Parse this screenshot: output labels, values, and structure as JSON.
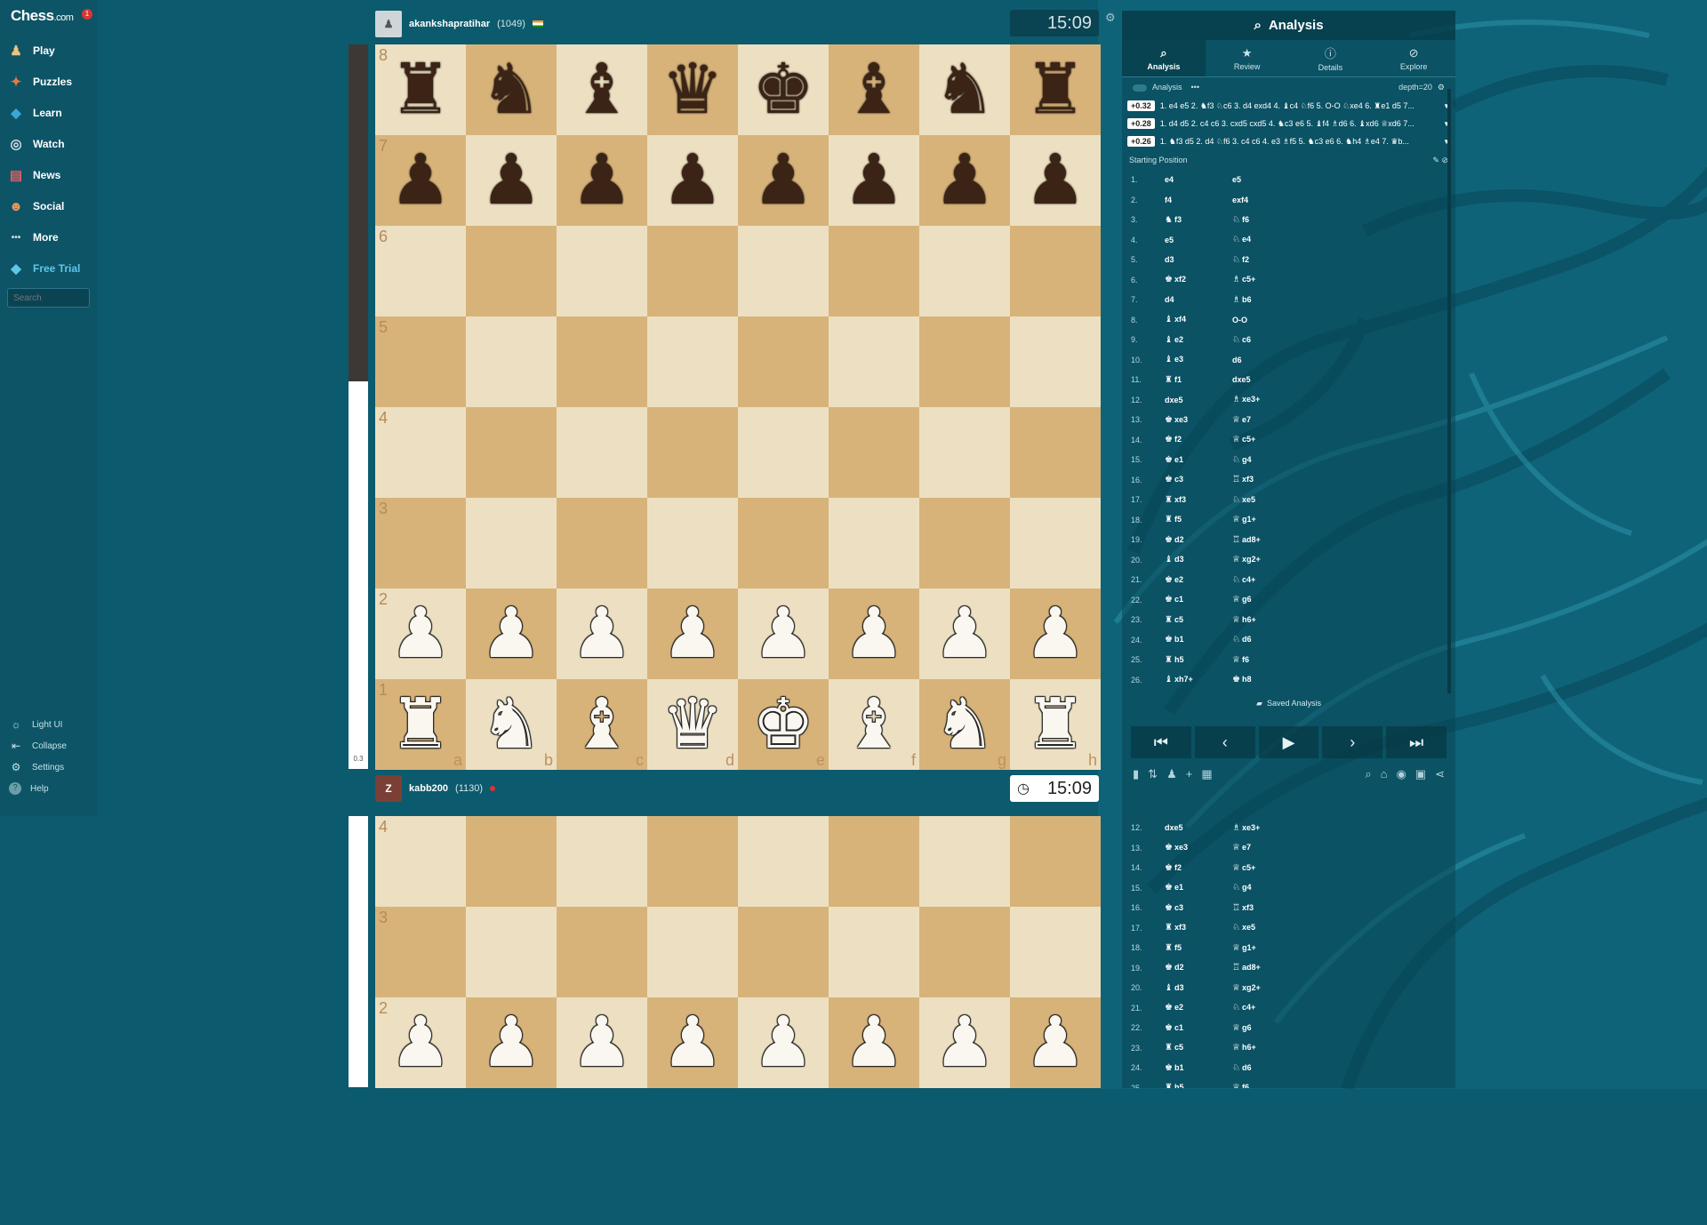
{
  "brand": {
    "logo_main": "Chess",
    "logo_suffix": ".com",
    "notification_count": "1"
  },
  "nav": [
    {
      "label": "Play",
      "icon": "play-pawn-icon",
      "glyph": "♟",
      "color": "#f0c27a"
    },
    {
      "label": "Puzzles",
      "icon": "puzzle-icon",
      "glyph": "✦",
      "color": "#e87a3d"
    },
    {
      "label": "Learn",
      "icon": "learn-icon",
      "glyph": "◆",
      "color": "#3aa6d6"
    },
    {
      "label": "Watch",
      "icon": "binoculars-icon",
      "glyph": "◎",
      "color": "#d7dde0"
    },
    {
      "label": "News",
      "icon": "news-icon",
      "glyph": "▤",
      "color": "#e85c5c"
    },
    {
      "label": "Social",
      "icon": "social-icon",
      "glyph": "☻",
      "color": "#e89a5c"
    },
    {
      "label": "More",
      "icon": "more-dots-icon",
      "glyph": "•••",
      "color": "#d7dde0"
    },
    {
      "label": "Free Trial",
      "icon": "diamond-icon",
      "glyph": "◆",
      "color": "#5fc6e8"
    }
  ],
  "search_placeholder": "Search",
  "footer": [
    {
      "label": "Light UI",
      "icon": "sun-icon",
      "glyph": "☼"
    },
    {
      "label": "Collapse",
      "icon": "collapse-icon",
      "glyph": "⇤"
    },
    {
      "label": "Settings",
      "icon": "gear-icon",
      "glyph": "⚙"
    },
    {
      "label": "Help",
      "icon": "help-icon",
      "glyph": "?"
    }
  ],
  "eval_bar": {
    "label": "0.3",
    "white_share": 0.535
  },
  "top_player": {
    "name": "akankshapratihar",
    "rating": "(1049)",
    "clock": "15:09"
  },
  "bottom_player": {
    "name": "kabb200",
    "rating": "(1130)",
    "avatar_letter": "Z",
    "clock": "15:09"
  },
  "board": {
    "ranks": [
      "8",
      "7",
      "6",
      "5",
      "4",
      "3",
      "2",
      "1"
    ],
    "files": [
      "a",
      "b",
      "c",
      "d",
      "e",
      "f",
      "g",
      "h"
    ],
    "position": [
      [
        "r",
        "n",
        "b",
        "q",
        "k",
        "b",
        "n",
        "r"
      ],
      [
        "p",
        "p",
        "p",
        "p",
        "p",
        "p",
        "p",
        "p"
      ],
      [
        "",
        "",
        "",
        "",
        "",
        "",
        "",
        ""
      ],
      [
        "",
        "",
        "",
        "",
        "",
        "",
        "",
        ""
      ],
      [
        "",
        "",
        "",
        "",
        "",
        "",
        "",
        ""
      ],
      [
        "",
        "",
        "",
        "",
        "",
        "",
        "",
        ""
      ],
      [
        "P",
        "P",
        "P",
        "P",
        "P",
        "P",
        "P",
        "P"
      ],
      [
        "R",
        "N",
        "B",
        "Q",
        "K",
        "B",
        "N",
        "R"
      ]
    ]
  },
  "board_duplicate": {
    "ranks": [
      "4",
      "3",
      "2"
    ],
    "position": [
      [
        "",
        "",
        "",
        "",
        "",
        "",
        "",
        ""
      ],
      [
        "",
        "",
        "",
        "",
        "",
        "",
        "",
        ""
      ],
      [
        "P",
        "P",
        "P",
        "P",
        "P",
        "P",
        "P",
        "P"
      ]
    ]
  },
  "analysis": {
    "title": "Analysis",
    "tabs": [
      {
        "label": "Analysis",
        "icon": "magnifier-icon",
        "glyph": "⌕"
      },
      {
        "label": "Review",
        "icon": "star-icon",
        "glyph": "★"
      },
      {
        "label": "Details",
        "icon": "info-icon",
        "glyph": "ⓘ"
      },
      {
        "label": "Explore",
        "icon": "compass-icon",
        "glyph": "⊘"
      }
    ],
    "toggle_label": "Analysis",
    "depth": "depth=20",
    "lines": [
      {
        "eval": "+0.32",
        "moves": "1. e4 e5 2. ♞f3 ♘c6 3. d4 exd4 4. ♝c4 ♘f6 5. O-O ♘xe4 6. ♜e1 d5 7..."
      },
      {
        "eval": "+0.28",
        "moves": "1. d4 d5 2. c4 c6 3. cxd5 cxd5 4. ♞c3 e6 5. ♝f4 ♗d6 6. ♝xd6 ♕xd6 7..."
      },
      {
        "eval": "+0.26",
        "moves": "1. ♞f3 d5 2. d4 ♘f6 3. c4 c6 4. e3 ♗f5 5. ♞c3 e6 6. ♞h4 ♗e4 7. ♛b..."
      }
    ],
    "starting_position": "Starting Position",
    "saved_label": "Saved Analysis"
  },
  "moves": [
    {
      "n": "1.",
      "w": "e4",
      "wp": "",
      "b": "e5",
      "bp": ""
    },
    {
      "n": "2.",
      "w": "f4",
      "wp": "",
      "b": "exf4",
      "bp": ""
    },
    {
      "n": "3.",
      "w": "f3",
      "wp": "♞",
      "b": "f6",
      "bp": "♘"
    },
    {
      "n": "4.",
      "w": "e5",
      "wp": "",
      "b": "e4",
      "bp": "♘"
    },
    {
      "n": "5.",
      "w": "d3",
      "wp": "",
      "b": "f2",
      "bp": "♘"
    },
    {
      "n": "6.",
      "w": "xf2",
      "wp": "♚",
      "b": "c5+",
      "bp": "♗"
    },
    {
      "n": "7.",
      "w": "d4",
      "wp": "",
      "b": "b6",
      "bp": "♗"
    },
    {
      "n": "8.",
      "w": "xf4",
      "wp": "♝",
      "b": "O-O",
      "bp": ""
    },
    {
      "n": "9.",
      "w": "e2",
      "wp": "♝",
      "b": "c6",
      "bp": "♘"
    },
    {
      "n": "10.",
      "w": "e3",
      "wp": "♝",
      "b": "d6",
      "bp": ""
    },
    {
      "n": "11.",
      "w": "f1",
      "wp": "♜",
      "b": "dxe5",
      "bp": ""
    },
    {
      "n": "12.",
      "w": "dxe5",
      "wp": "",
      "b": "xe3+",
      "bp": "♗"
    },
    {
      "n": "13.",
      "w": "xe3",
      "wp": "♚",
      "b": "e7",
      "bp": "♕"
    },
    {
      "n": "14.",
      "w": "f2",
      "wp": "♚",
      "b": "c5+",
      "bp": "♕"
    },
    {
      "n": "15.",
      "w": "e1",
      "wp": "♚",
      "b": "g4",
      "bp": "♘"
    },
    {
      "n": "16.",
      "w": "c3",
      "wp": "♚",
      "b": "xf3",
      "bp": "♖"
    },
    {
      "n": "17.",
      "w": "xf3",
      "wp": "♜",
      "b": "xe5",
      "bp": "♘"
    },
    {
      "n": "18.",
      "w": "f5",
      "wp": "♜",
      "b": "g1+",
      "bp": "♕"
    },
    {
      "n": "19.",
      "w": "d2",
      "wp": "♚",
      "b": "ad8+",
      "bp": "♖"
    },
    {
      "n": "20.",
      "w": "d3",
      "wp": "♝",
      "b": "xg2+",
      "bp": "♕"
    },
    {
      "n": "21.",
      "w": "e2",
      "wp": "♚",
      "b": "c4+",
      "bp": "♘"
    },
    {
      "n": "22.",
      "w": "c1",
      "wp": "♚",
      "b": "g6",
      "bp": "♕"
    },
    {
      "n": "23.",
      "w": "c5",
      "wp": "♜",
      "b": "h6+",
      "bp": "♕"
    },
    {
      "n": "24.",
      "w": "b1",
      "wp": "♚",
      "b": "d6",
      "bp": "♘"
    },
    {
      "n": "25.",
      "w": "h5",
      "wp": "♜",
      "b": "f6",
      "bp": "♕"
    },
    {
      "n": "26.",
      "w": "xh7+",
      "wp": "♝",
      "b": "h8",
      "bp": "♚"
    }
  ],
  "moves_duplicate_start": 11,
  "controls": [
    {
      "name": "first-move-button",
      "glyph": "⏮"
    },
    {
      "name": "previous-move-button",
      "glyph": "‹"
    },
    {
      "name": "play-button",
      "glyph": "▶"
    },
    {
      "name": "next-move-button",
      "glyph": "›"
    },
    {
      "name": "last-move-button",
      "glyph": "⏭"
    }
  ],
  "tools_left": [
    {
      "name": "graph-icon",
      "glyph": "▮"
    },
    {
      "name": "flip-board-icon",
      "glyph": "⇅"
    },
    {
      "name": "piece-icon",
      "glyph": "♟"
    },
    {
      "name": "plus-icon",
      "glyph": "+"
    },
    {
      "name": "grid-icon",
      "glyph": "▦"
    }
  ],
  "tools_right": [
    {
      "name": "zoom-icon",
      "glyph": "⌕"
    },
    {
      "name": "library-icon",
      "glyph": "⌂"
    },
    {
      "name": "target-icon",
      "glyph": "◉"
    },
    {
      "name": "camera-icon",
      "glyph": "▣"
    },
    {
      "name": "share-icon",
      "glyph": "⋖"
    }
  ]
}
